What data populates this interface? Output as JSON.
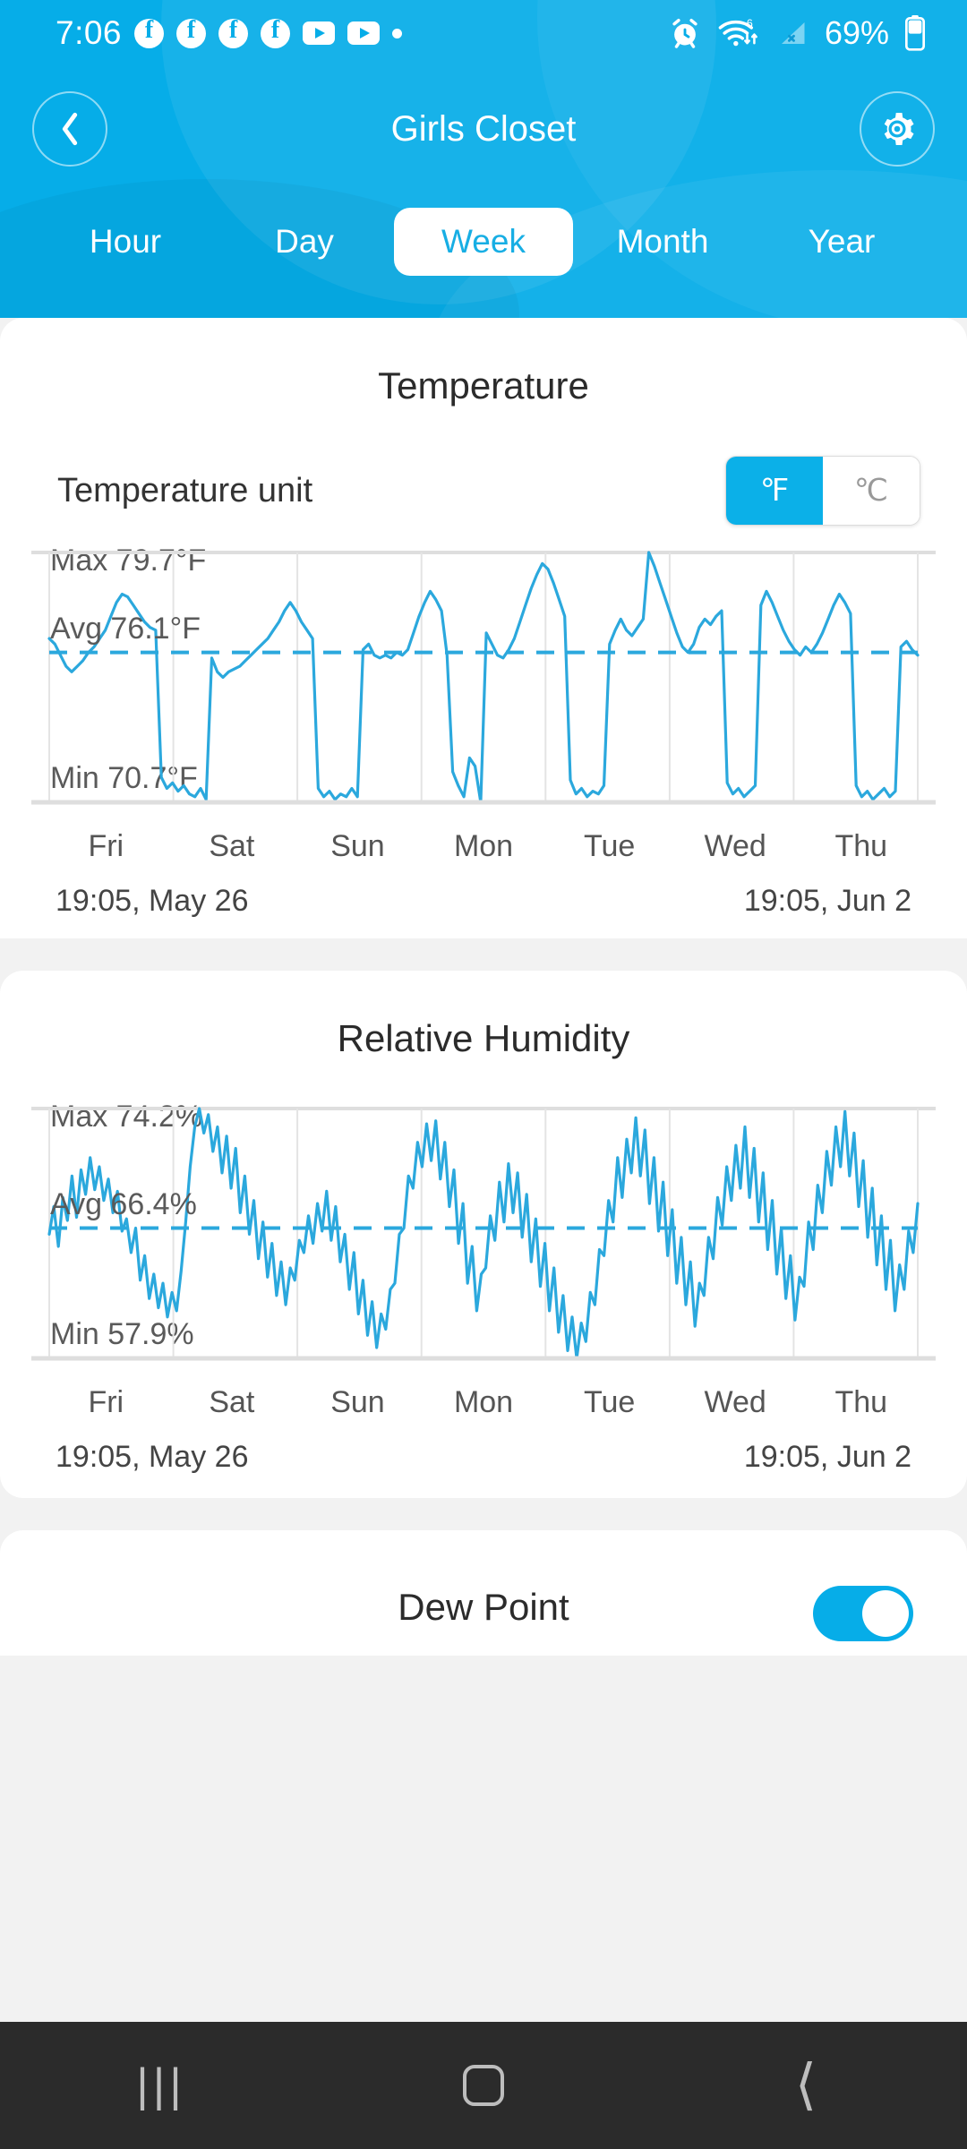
{
  "status_bar": {
    "time": "7:06",
    "notification_icons": [
      "facebook-icon",
      "facebook-icon",
      "facebook-icon",
      "facebook-icon",
      "youtube-icon",
      "youtube-icon",
      "more-notifications-dot"
    ],
    "right_icons": [
      "alarm-icon",
      "wifi6-icon",
      "cellular-no-signal-icon"
    ],
    "battery_percent": "69%"
  },
  "header": {
    "title": "Girls Closet",
    "back_icon": "chevron-left-icon",
    "settings_icon": "gear-icon",
    "background_color": "#06ADE8"
  },
  "tabs": {
    "items": [
      {
        "label": "Hour",
        "active": false
      },
      {
        "label": "Day",
        "active": false
      },
      {
        "label": "Week",
        "active": true
      },
      {
        "label": "Month",
        "active": false
      },
      {
        "label": "Year",
        "active": false
      }
    ],
    "active_text_color": "#17AEE4",
    "active_pill_color": "#FFFFFF"
  },
  "temperature_card": {
    "title": "Temperature",
    "unit_label": "Temperature unit",
    "unit_options": [
      {
        "label": "℉",
        "selected": true
      },
      {
        "label": "℃",
        "selected": false
      }
    ],
    "stat_max": "Max 79.7°F",
    "stat_avg": "Avg 76.1°F",
    "stat_min": "Min 70.7°F",
    "day_labels": [
      "Fri",
      "Sat",
      "Sun",
      "Mon",
      "Tue",
      "Wed",
      "Thu"
    ],
    "range_start": "19:05,  May 26",
    "range_end": "19:05,  Jun 2"
  },
  "humidity_card": {
    "title": "Relative Humidity",
    "stat_max": "Max 74.2%",
    "stat_avg": "Avg 66.4%",
    "stat_min": "Min 57.9%",
    "day_labels": [
      "Fri",
      "Sat",
      "Sun",
      "Mon",
      "Tue",
      "Wed",
      "Thu"
    ],
    "range_start": "19:05,  May 26",
    "range_end": "19:05,  Jun 2"
  },
  "dew_point_card": {
    "title": "Dew Point",
    "toggle_on": true,
    "toggle_color": "#06ADE8"
  },
  "nav_bar": {
    "recents_icon": "|||",
    "home_icon": "home-square-icon",
    "back_icon": "chevron-left-icon"
  },
  "chart_data": [
    {
      "type": "line",
      "title": "Temperature",
      "xlabel": "",
      "ylabel": "°F",
      "series_color": "#2BA8DD",
      "avg_line_color": "#2BA8DD",
      "grid": true,
      "ylim": [
        70.7,
        79.7
      ],
      "max": 79.7,
      "avg": 76.1,
      "min": 70.7,
      "unit": "°F",
      "categories": [
        "Fri",
        "Sat",
        "Sun",
        "Mon",
        "Tue",
        "Wed",
        "Thu"
      ],
      "x_start": "19:05, May 26",
      "x_end": "19:05, Jun 2",
      "values": [
        76.6,
        76.4,
        76.0,
        75.6,
        75.4,
        75.6,
        75.8,
        76.1,
        76.3,
        76.6,
        76.9,
        77.4,
        77.9,
        78.2,
        78.1,
        77.8,
        77.5,
        77.2,
        77.0,
        76.9,
        71.6,
        71.2,
        71.4,
        71.1,
        71.3,
        71.0,
        70.9,
        71.2,
        70.8,
        75.9,
        75.4,
        75.2,
        75.4,
        75.5,
        75.6,
        75.8,
        76.0,
        76.2,
        76.4,
        76.6,
        76.9,
        77.2,
        77.6,
        77.9,
        77.6,
        77.2,
        76.9,
        76.6,
        71.2,
        70.9,
        71.1,
        70.8,
        71.0,
        70.9,
        71.2,
        70.9,
        76.2,
        76.4,
        76.0,
        75.9,
        76.0,
        75.9,
        76.1,
        76.0,
        76.2,
        76.8,
        77.4,
        77.9,
        78.3,
        78.0,
        77.6,
        76.0,
        71.8,
        71.3,
        70.9,
        72.3,
        72.0,
        70.7,
        76.8,
        76.4,
        76.0,
        75.9,
        76.2,
        76.6,
        77.2,
        77.8,
        78.4,
        78.9,
        79.3,
        79.1,
        78.6,
        78.0,
        77.4,
        71.5,
        71.0,
        71.2,
        70.9,
        71.1,
        71.0,
        71.3,
        76.4,
        76.9,
        77.3,
        76.9,
        76.7,
        77.0,
        77.3,
        79.7,
        79.2,
        78.6,
        78.0,
        77.4,
        76.8,
        76.3,
        76.1,
        76.4,
        77.0,
        77.3,
        77.1,
        77.4,
        77.6,
        71.4,
        71.0,
        71.2,
        70.9,
        71.1,
        71.3,
        77.8,
        78.3,
        77.9,
        77.4,
        76.9,
        76.5,
        76.2,
        76.0,
        76.3,
        76.1,
        76.4,
        76.8,
        77.3,
        77.8,
        78.2,
        77.9,
        77.5,
        71.3,
        70.9,
        71.1,
        70.8,
        71.0,
        71.2,
        70.9,
        71.1,
        76.3,
        76.5,
        76.2,
        76.0
      ]
    },
    {
      "type": "line",
      "title": "Relative Humidity",
      "xlabel": "",
      "ylabel": "%",
      "series_color": "#2BA8DD",
      "avg_line_color": "#2BA8DD",
      "grid": true,
      "ylim": [
        57.9,
        74.2
      ],
      "max": 74.2,
      "avg": 66.4,
      "min": 57.9,
      "unit": "%",
      "categories": [
        "Fri",
        "Sat",
        "Sun",
        "Mon",
        "Tue",
        "Wed",
        "Thu"
      ],
      "x_start": "19:05, May 26",
      "x_end": "19:05, Jun 2",
      "values": [
        66.0,
        67.8,
        65.2,
        68.4,
        66.9,
        69.8,
        67.1,
        70.2,
        68.6,
        71.0,
        68.9,
        70.4,
        68.2,
        69.6,
        67.4,
        68.8,
        66.2,
        67.0,
        64.8,
        66.4,
        63.0,
        64.6,
        61.8,
        63.4,
        61.2,
        62.8,
        60.6,
        62.2,
        61.0,
        63.6,
        66.8,
        70.4,
        73.0,
        74.2,
        72.6,
        73.8,
        71.4,
        73.0,
        70.0,
        72.4,
        69.0,
        71.6,
        67.4,
        69.8,
        66.0,
        68.2,
        64.4,
        66.8,
        63.2,
        65.4,
        62.0,
        64.2,
        61.4,
        63.8,
        63.0,
        65.6,
        64.8,
        67.2,
        65.4,
        68.0,
        66.2,
        68.8,
        65.6,
        67.8,
        64.2,
        66.0,
        62.4,
        64.8,
        60.8,
        63.0,
        59.4,
        61.6,
        58.6,
        60.8,
        59.8,
        62.4,
        62.8,
        66.0,
        66.4,
        69.8,
        69.0,
        72.0,
        70.4,
        73.2,
        70.8,
        73.4,
        69.6,
        72.0,
        67.8,
        70.2,
        65.4,
        68.0,
        62.8,
        65.2,
        61.0,
        63.4,
        63.8,
        67.2,
        65.6,
        69.4,
        66.8,
        70.6,
        67.4,
        70.0,
        65.8,
        68.6,
        64.2,
        67.0,
        62.6,
        65.4,
        61.0,
        63.8,
        59.6,
        62.0,
        58.4,
        60.6,
        57.9,
        60.2,
        59.0,
        62.2,
        61.4,
        65.0,
        64.6,
        68.2,
        66.8,
        71.0,
        68.4,
        72.2,
        70.0,
        73.6,
        69.8,
        72.8,
        68.0,
        71.0,
        66.2,
        69.4,
        64.6,
        67.6,
        62.8,
        65.8,
        61.4,
        64.2,
        60.0,
        62.8,
        62.0,
        65.8,
        64.4,
        68.4,
        66.6,
        70.4,
        68.2,
        71.8,
        69.0,
        73.0,
        68.4,
        71.6,
        66.8,
        70.0,
        65.0,
        68.2,
        63.4,
        66.4,
        61.8,
        64.6,
        60.4,
        63.2,
        62.6,
        66.8,
        65.0,
        69.2,
        67.4,
        71.4,
        69.2,
        73.0,
        70.4,
        74.0,
        69.8,
        72.6,
        67.8,
        70.8,
        65.8,
        69.0,
        64.0,
        67.2,
        62.4,
        65.6,
        61.0,
        64.0,
        62.4,
        66.2,
        64.8,
        68.0
      ]
    }
  ]
}
